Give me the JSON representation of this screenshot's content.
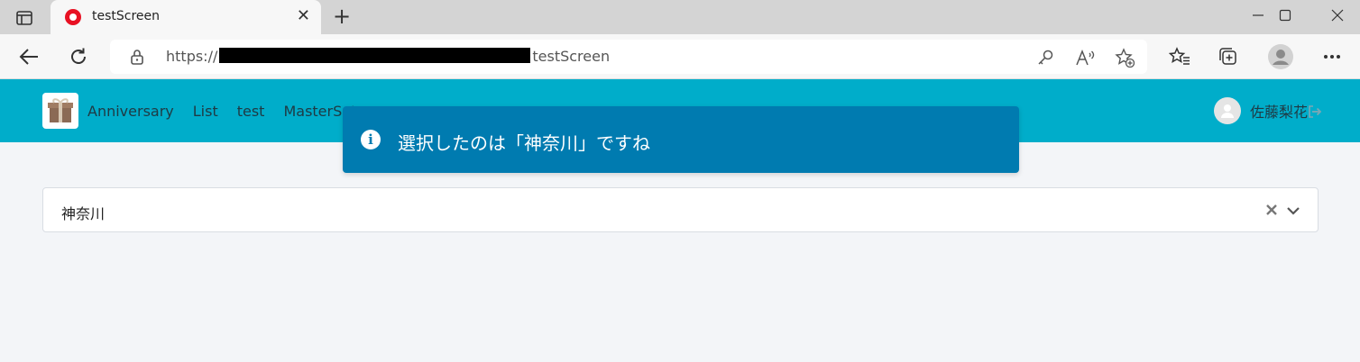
{
  "browser": {
    "tab_title": "testScreen",
    "url_prefix": "https://",
    "url_suffix": "testScreen"
  },
  "navbar": {
    "items": [
      "Anniversary",
      "List",
      "test",
      "MasterSet"
    ],
    "user_name": "佐藤梨花"
  },
  "toast": {
    "message": "選択したのは「神奈川」ですね"
  },
  "select": {
    "value": "神奈川"
  },
  "colors": {
    "navbar": "#00adca",
    "toast": "#007bb0",
    "page_bg": "#f3f5f8"
  }
}
